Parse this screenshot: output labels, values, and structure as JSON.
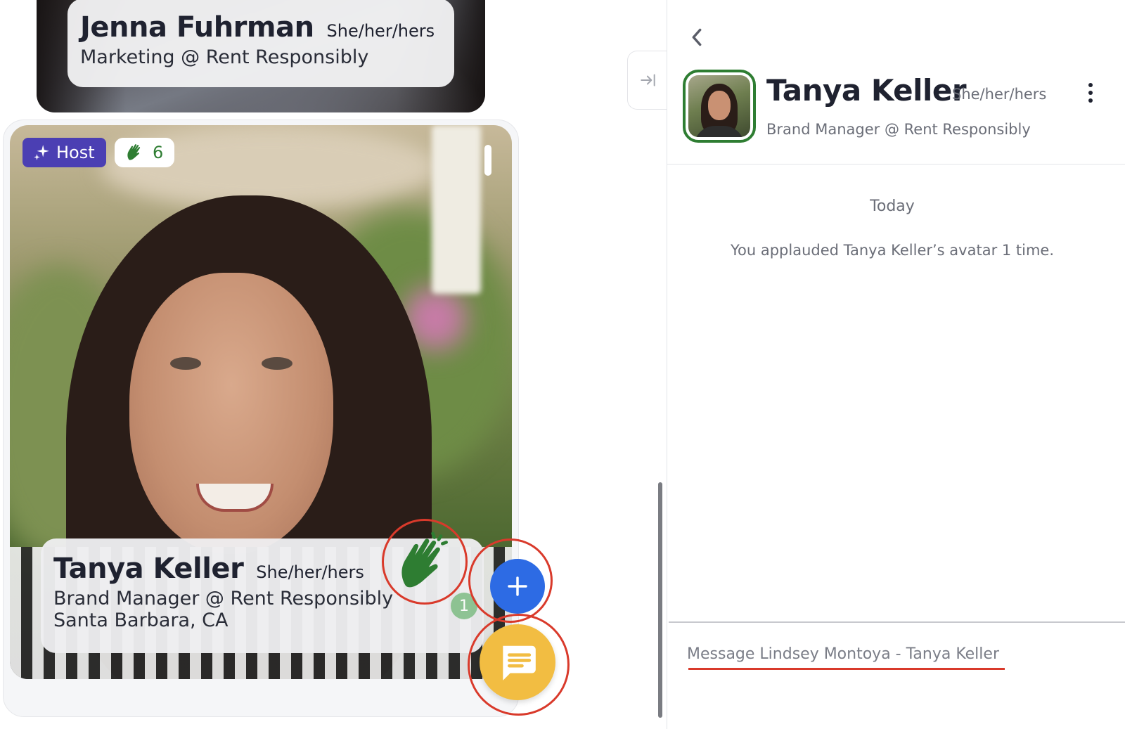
{
  "attendees": [
    {
      "name": "Jenna Fuhrman",
      "pronouns": "She/her/hers",
      "role": "Marketing @ Rent Responsibly"
    },
    {
      "name": "Tanya Keller",
      "pronouns": "She/her/hers",
      "role": "Brand Manager @ Rent Responsibly",
      "location": "Santa Barbara, CA",
      "host_badge": "Host",
      "applause_total": "6",
      "my_applause_count": "1"
    }
  ],
  "icons": {
    "host": "sparkle-icon",
    "applause": "clapping-hands-icon",
    "add": "plus-icon",
    "chat": "chat-bubble-icon",
    "collapse": "collapse-right-icon",
    "back": "chevron-left-icon",
    "more": "more-vertical-icon"
  },
  "chat_panel": {
    "contact_name": "Tanya Keller",
    "contact_pronouns": "She/her/hers",
    "contact_role": "Brand Manager @ Rent Responsibly",
    "day_label": "Today",
    "system_message": "You applauded Tanya Keller’s avatar 1 time.",
    "composer_placeholder": "Message Lindsey Montoya - Tanya Keller"
  },
  "colors": {
    "host_badge": "#4b3fb3",
    "applause_green": "#2e7d32",
    "add_button": "#2d6be4",
    "chat_button": "#f2bd42",
    "highlight_ring": "#d93a2b"
  }
}
